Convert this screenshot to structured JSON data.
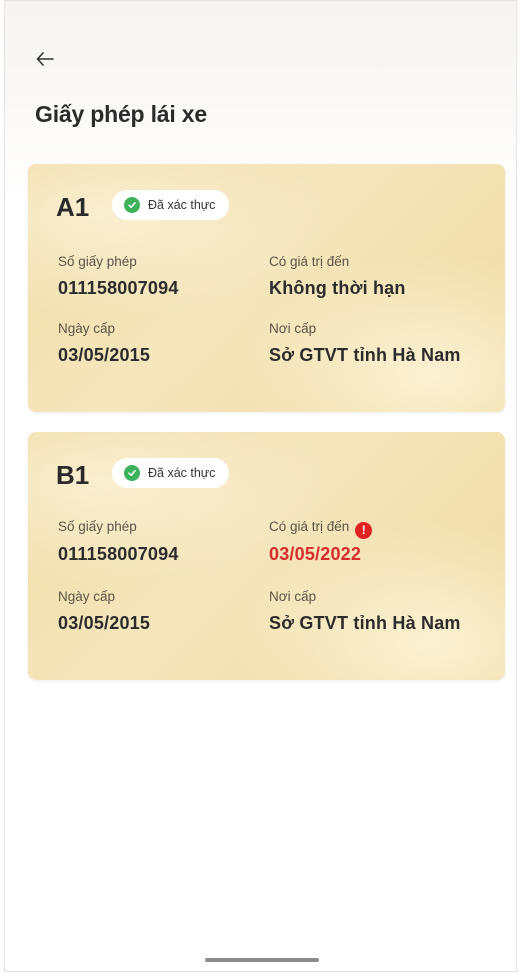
{
  "header": {
    "title": "Giấy phép lái xe"
  },
  "labels": {
    "license_number": "Số giấy phép",
    "valid_until": "Có giá trị đến",
    "issue_date": "Ngày cấp",
    "issue_place": "Nơi cấp"
  },
  "licenses": [
    {
      "class": "A1",
      "status": "Đã xác thực",
      "license_number": "011158007094",
      "valid_until": "Không thời hạn",
      "issue_date": "03/05/2015",
      "issue_place": "Sở GTVT tỉnh Hà Nam"
    },
    {
      "class": "B1",
      "status": "Đã xác thực",
      "license_number": "011158007094",
      "valid_until": "03/05/2022",
      "issue_date": "03/05/2015",
      "issue_place": "Sở GTVT tỉnh Hà Nam"
    }
  ],
  "colors": {
    "verified_green": "#3cb35a",
    "expired_red": "#d72c2c",
    "card_gold": "#f0dca6"
  },
  "icons": {
    "back": "arrow-left-icon",
    "verified": "check-circle-icon",
    "warning": "exclamation-circle-icon"
  }
}
